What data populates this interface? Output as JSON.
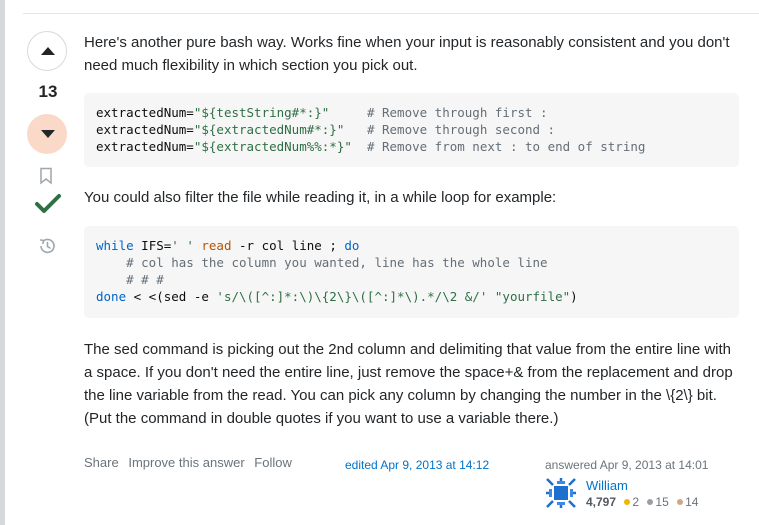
{
  "vote": {
    "count": "13"
  },
  "post": {
    "paragraph1": "Here's another pure bash way. Works fine when your input is reasonably consistent and you don't need much flexibility in which section you pick out.",
    "code1": [
      {
        "cmd": "extractedNum=",
        "str": "\"${testString#*:}\"",
        "pad": "     ",
        "comment": "# Remove through first :"
      },
      {
        "cmd": "extractedNum=",
        "str": "\"${extractedNum#*:}\"",
        "pad": "   ",
        "comment": "# Remove through second :"
      },
      {
        "cmd": "extractedNum=",
        "str": "\"${extractedNum%%:*}\"",
        "pad": "  ",
        "comment": "# Remove from next : to end of string"
      }
    ],
    "paragraph2": "You could also filter the file while reading it, in a while loop for example:",
    "code2": {
      "line1_kw1": "while",
      "line1_a": " IFS=",
      "line1_str": "' '",
      "line1_kw2": " read",
      "line1_b": " -r col line ; ",
      "line1_kw3": "do",
      "line2": "    # col has the column you wanted, line has the whole line",
      "line3": "    # # #",
      "line4_kw": "done",
      "line4_a": " < <(sed -e ",
      "line4_str1": "'s/\\([^:]*:\\)\\{2\\}\\([^:]*\\).*/\\2 &/'",
      "line4_b": " ",
      "line4_str2": "\"yourfile\"",
      "line4_c": ")"
    },
    "paragraph3": "The sed command is picking out the 2nd column and delimiting that value from the entire line with a space. If you don't need the entire line, just remove the space+& from the replacement and drop the line variable from the read. You can pick any column by changing the number in the \\{2\\} bit. (Put the command in double quotes if you want to use a variable there.)"
  },
  "footer": {
    "share": "Share",
    "improve": "Improve this answer",
    "follow": "Follow",
    "edited": "edited Apr 9, 2013 at 14:12",
    "answered": "answered Apr 9, 2013 at 14:01",
    "user": {
      "name": "William",
      "reputation": "4,797",
      "gold": "2",
      "silver": "15",
      "bronze": "14"
    }
  },
  "colors": {
    "link": "#0074cc",
    "accepted": "#2f6f44",
    "downvote_active": "#fbd9c8",
    "gold": "#f1b600",
    "silver": "#9a9fa5",
    "bronze": "#d1a684"
  }
}
